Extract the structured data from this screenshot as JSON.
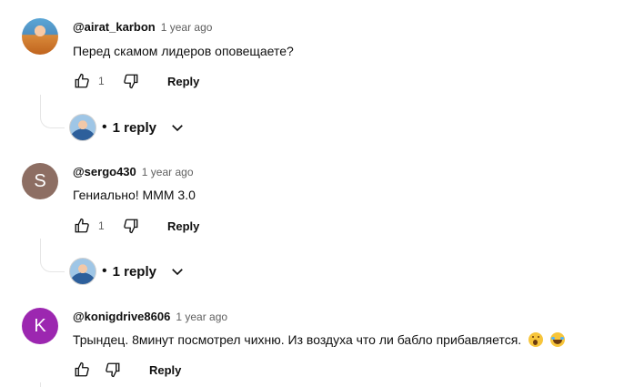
{
  "comments": [
    {
      "handle": "@airat_karbon",
      "time": "1 year ago",
      "text": "Перед скамом лидеров оповещаете?",
      "likes": "1",
      "reply_label": "Reply",
      "replies_label": "1 reply",
      "avatar_type": "photo"
    },
    {
      "handle": "@sergo430",
      "time": "1 year ago",
      "text": "Гениально! МММ 3.0",
      "likes": "1",
      "reply_label": "Reply",
      "replies_label": "1 reply",
      "avatar_letter": "S",
      "avatar_color": "#8d6e63"
    },
    {
      "handle": "@konigdrive8606",
      "time": "1 year ago",
      "text": "Трындец. 8минут посмотрел чихню. Из воздуха что ли бабло прибавляется.",
      "emojis": [
        "face-with-open-mouth",
        "rolling-on-floor-laughing"
      ],
      "likes": "",
      "reply_label": "Reply",
      "avatar_letter": "K",
      "avatar_color": "#9c27b0"
    }
  ],
  "separator_dot": "•",
  "icons": {
    "like": "thumbs-up-icon",
    "dislike": "thumbs-down-icon",
    "expand": "chevron-down-icon"
  }
}
